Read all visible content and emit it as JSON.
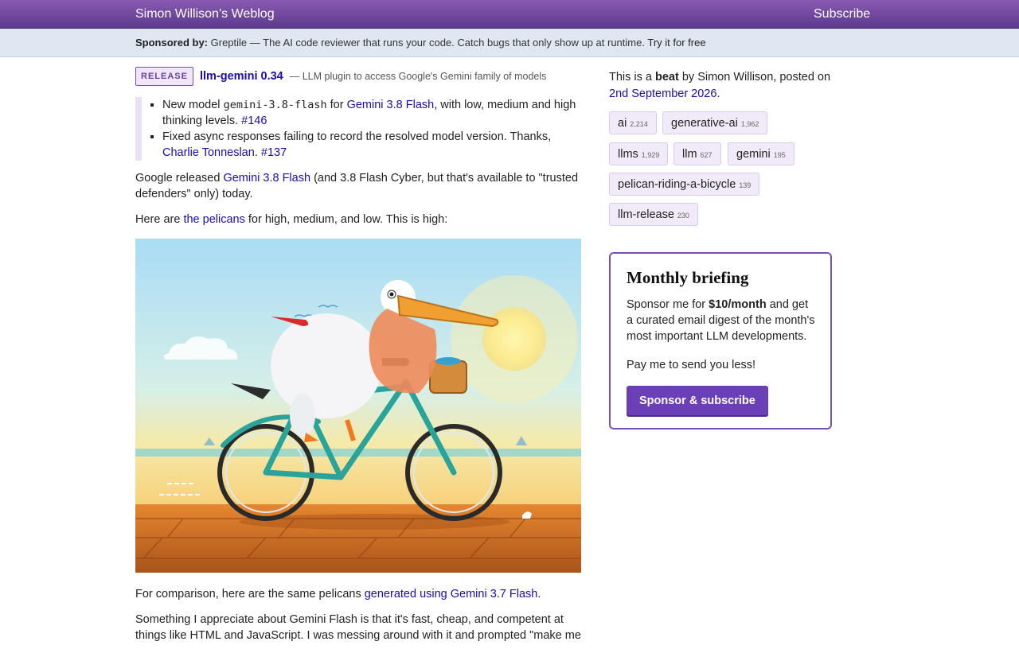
{
  "header": {
    "site_title": "Simon Willison’s Weblog",
    "subscribe": "Subscribe"
  },
  "sponsor": {
    "label": "Sponsored by:",
    "text": "Greptile — The AI code reviewer that runs your code. Catch bugs that only show up at runtime.",
    "link": "Try it for free"
  },
  "release": {
    "badge": "RELEASE",
    "title": "llm-gemini 0.34",
    "desc": "— LLM plugin to access Google's Gemini family of models"
  },
  "notes": {
    "item1_a": "New model ",
    "item1_code": "gemini-3.8-flash",
    "item1_b": " for ",
    "item1_link": "Gemini 3.8 Flash",
    "item1_c": ", with low, medium and high thinking levels. ",
    "item1_issue": "#146",
    "item2_a": "Fixed async responses failing to record the resolved model version. Thanks, ",
    "item2_link": "Charlie Tonneslan",
    "item2_sep": ". ",
    "item2_issue": "#137"
  },
  "body": {
    "p1_a": "Google released ",
    "p1_link": "Gemini 3.8 Flash",
    "p1_b": " (and 3.8 Flash Cyber, but that's available to \"trusted defenders\" only) today.",
    "p2_a": "Here are ",
    "p2_link": "the pelicans",
    "p2_b": " for high, medium, and low. This is high:",
    "p3_a": "For comparison, here are the same pelicans ",
    "p3_link": "generated using Gemini 3.7 Flash",
    "p3_b": ".",
    "p4": "Something I appreciate about Gemini Flash is that it's fast, cheap, and competent at things like HTML and JavaScript. I was messing around with it and prompted \"make me"
  },
  "sidebar": {
    "intro_a": "This is a ",
    "intro_bold": "beat",
    "intro_b": " by Simon Willison, posted on ",
    "date": "2nd September 2026",
    "intro_c": "."
  },
  "tags": [
    {
      "name": "ai",
      "count": "2,214"
    },
    {
      "name": "generative-ai",
      "count": "1,962"
    },
    {
      "name": "llms",
      "count": "1,929"
    },
    {
      "name": "llm",
      "count": "627"
    },
    {
      "name": "gemini",
      "count": "195"
    },
    {
      "name": "pelican-riding-a-bicycle",
      "count": "139"
    },
    {
      "name": "llm-release",
      "count": "230"
    }
  ],
  "briefing": {
    "title": "Monthly briefing",
    "text_a": "Sponsor me for ",
    "price": "$10/month",
    "text_b": " and get a curated email digest of the month's most important LLM developments.",
    "text2": "Pay me to send you less!",
    "button": "Sponsor & subscribe"
  },
  "colors": {
    "accent": "#6b3fb8",
    "header": "#5b3a8c",
    "link": "#1a0dab"
  }
}
